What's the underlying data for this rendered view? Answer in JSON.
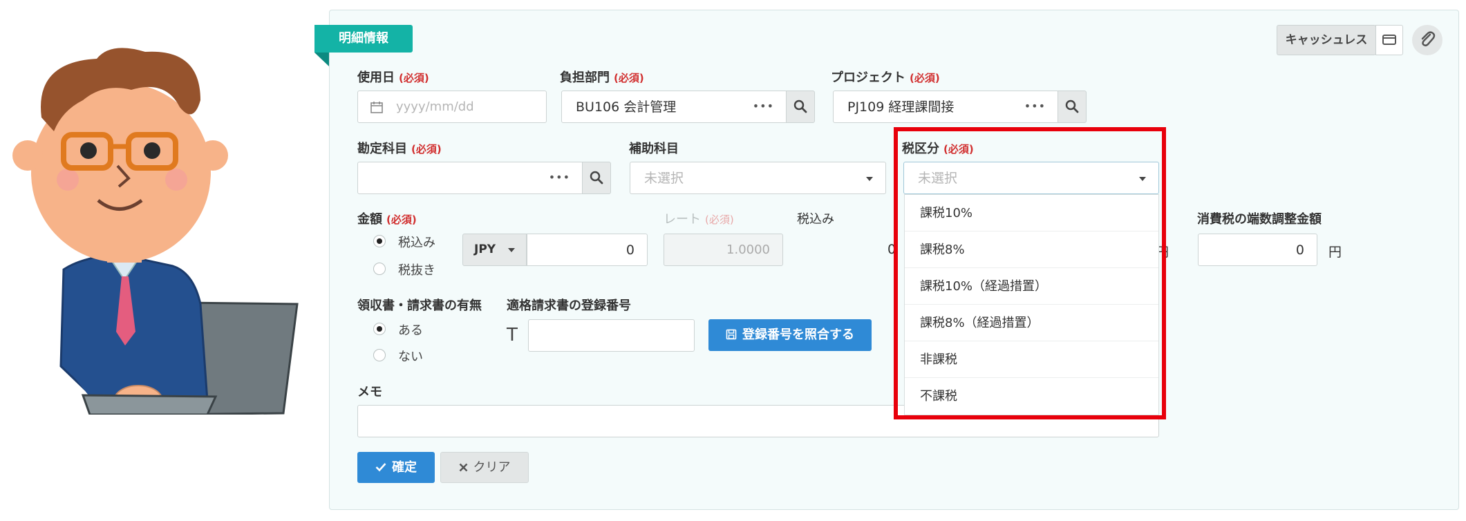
{
  "badge": "明細情報",
  "cashless_button": "キャッシュレス",
  "fields": {
    "usage_date": {
      "label": "使用日",
      "required": "(必須)",
      "placeholder": "yyyy/mm/dd"
    },
    "department": {
      "label": "負担部門",
      "required": "(必須)",
      "value": "BU106 会計管理"
    },
    "project": {
      "label": "プロジェクト",
      "required": "(必須)",
      "value": "PJ109 経理課間接"
    },
    "account": {
      "label": "勘定科目",
      "required": "(必須)"
    },
    "sub_account": {
      "label": "補助科目",
      "placeholder": "未選択"
    },
    "tax_category": {
      "label": "税区分",
      "required": "(必須)",
      "placeholder": "未選択",
      "options": [
        "課税10%",
        "課税8%",
        "課税10%（経過措置）",
        "課税8%（経過措置）",
        "非課税",
        "不課税"
      ]
    },
    "amount": {
      "label": "金額",
      "required": "(必須)",
      "option_incl": "税込み",
      "option_excl": "税抜き",
      "currency": "JPY",
      "value": "0"
    },
    "rate": {
      "label": "レート",
      "required": "(必須)",
      "value": "1.0000"
    },
    "tax_included": {
      "label": "税込み",
      "value": "0"
    },
    "tax_adjust": {
      "label": "消費税の端数調整金額",
      "value": "0",
      "unit": "円",
      "prev_unit": "円",
      "prev_value": "0"
    },
    "receipt": {
      "label": "領収書・請求書の有無",
      "option_yes": "ある",
      "option_no": "ない"
    },
    "invoice_number": {
      "label": "適格請求書の登録番号",
      "prefix": "T",
      "button": "登録番号を照合する"
    },
    "memo": {
      "label": "メモ"
    }
  },
  "actions": {
    "confirm": "確定",
    "clear": "クリア"
  },
  "colors": {
    "accent": "#14b3a6",
    "primary": "#2f8ad6",
    "required": "#d12f2f",
    "highlight": "#e8000b"
  }
}
